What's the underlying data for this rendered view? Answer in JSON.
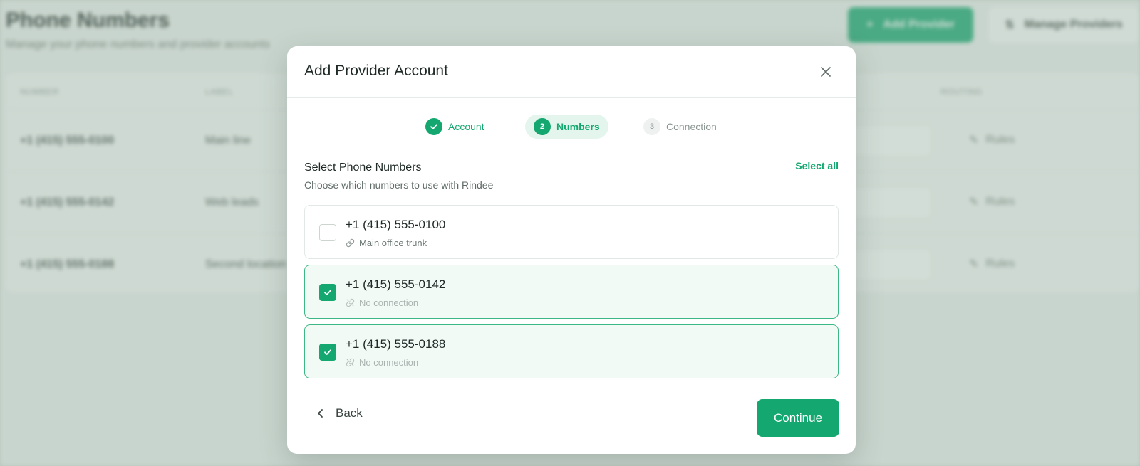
{
  "background": {
    "title": "Phone Numbers",
    "subtitle": "Manage your phone numbers and provider accounts",
    "add_provider_label": "Add Provider",
    "manage_providers_label": "Manage Providers",
    "table_headers": [
      "NUMBER",
      "LABEL",
      "ROUTING"
    ],
    "rows": [
      {
        "number": "+1 (415) 555-0100",
        "label": "Main line",
        "routing": "Rules"
      },
      {
        "number": "+1 (415) 555-0142",
        "label": "Web leads",
        "routing": "Rules"
      },
      {
        "number": "+1 (415) 555-0188",
        "label": "Second location",
        "routing": "Rules"
      }
    ]
  },
  "modal": {
    "title": "Add Provider Account",
    "steps": [
      {
        "number": "1",
        "label": "Account",
        "state": "done"
      },
      {
        "number": "2",
        "label": "Numbers",
        "state": "active"
      },
      {
        "number": "3",
        "label": "Connection",
        "state": "pending"
      }
    ],
    "section_title": "Select Phone Numbers",
    "section_description": "Choose which numbers to use with Rindee",
    "select_all_label": "Select all",
    "numbers": [
      {
        "phone": "+1 (415) 555-0100",
        "meta": "Main office trunk",
        "checked": false,
        "linked": true
      },
      {
        "phone": "+1 (415) 555-0142",
        "meta": "No connection",
        "checked": true,
        "linked": false
      },
      {
        "phone": "+1 (415) 555-0188",
        "meta": "No connection",
        "checked": true,
        "linked": false
      }
    ],
    "back_label": "Back",
    "continue_label": "Continue"
  },
  "colors": {
    "accent": "#14a870",
    "accent_light": "#e3f5ec",
    "checked_bg": "#f2faf6",
    "text_primary": "#1f2a26",
    "text_muted": "#8a9590"
  }
}
